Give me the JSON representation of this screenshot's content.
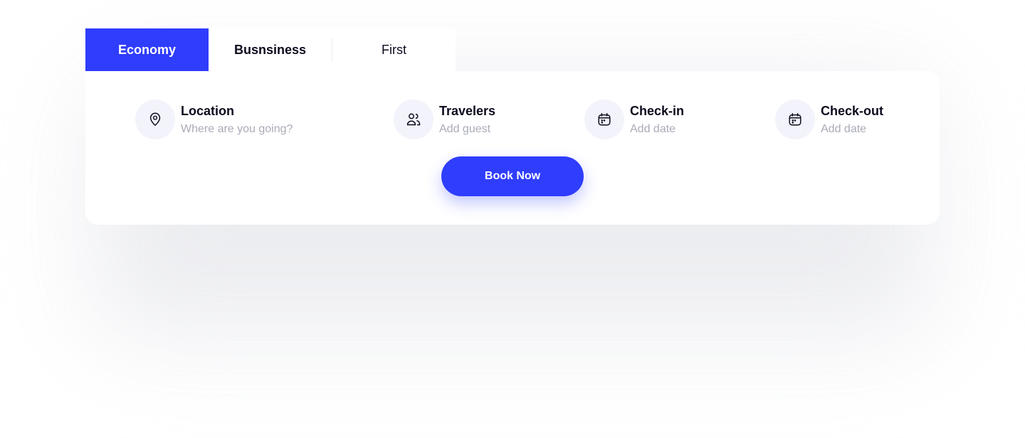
{
  "tabs": [
    {
      "label": "Economy",
      "active": true
    },
    {
      "label": "Busnsiness",
      "active": false
    },
    {
      "label": "First",
      "active": false
    }
  ],
  "fields": {
    "location": {
      "title": "Location",
      "placeholder": "Where are you going?",
      "icon": "location-pin-icon"
    },
    "travelers": {
      "title": "Travelers",
      "placeholder": "Add guest",
      "icon": "users-icon"
    },
    "checkin": {
      "title": "Check-in",
      "placeholder": "Add date",
      "icon": "calendar-icon"
    },
    "checkout": {
      "title": "Check-out",
      "placeholder": "Add date",
      "icon": "calendar-icon"
    }
  },
  "book_button": {
    "label": "Book Now"
  },
  "colors": {
    "accent": "#2f3dfc",
    "text": "#0b0b1e",
    "muted": "#a9abb8",
    "icon_bg": "#f3f3fb"
  }
}
